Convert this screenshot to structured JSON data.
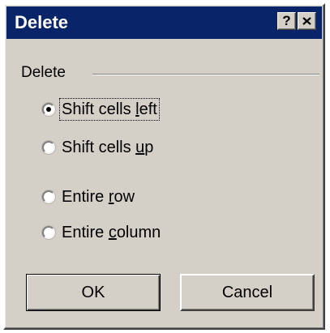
{
  "window": {
    "title": "Delete",
    "help_label": "?",
    "close_label": "×"
  },
  "group": {
    "label": "Delete"
  },
  "options": [
    {
      "pre": "Shift cells ",
      "accel": "l",
      "post": "eft",
      "selected": true
    },
    {
      "pre": "Shift cells ",
      "accel": "u",
      "post": "p",
      "selected": false
    },
    {
      "pre": "Entire ",
      "accel": "r",
      "post": "ow",
      "selected": false
    },
    {
      "pre": "Entire ",
      "accel": "c",
      "post": "olumn",
      "selected": false
    }
  ],
  "buttons": {
    "ok_label": "OK",
    "cancel_label": "Cancel"
  },
  "colors": {
    "titlebar": "#0a246a",
    "face": "#d4d0c8"
  }
}
